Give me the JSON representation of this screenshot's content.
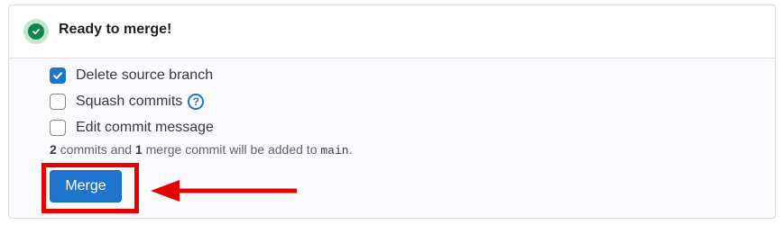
{
  "header": {
    "title": "Ready to merge!",
    "status_icon": "check-circle-icon",
    "status_color": "#108548"
  },
  "options": [
    {
      "label": "Delete source branch",
      "checked": true
    },
    {
      "label": "Squash commits",
      "checked": false,
      "help_icon": "question-circle-icon"
    },
    {
      "label": "Edit commit message",
      "checked": false
    }
  ],
  "summary": {
    "commit_count": "2",
    "commits_text": " commits and ",
    "merge_commit_count": "1",
    "merge_commit_text": " merge commit will be added to ",
    "target_branch": "main",
    "end": "."
  },
  "merge_button": {
    "label": "Merge",
    "color": "#1f75cb"
  },
  "annotation": {
    "highlight_color": "#e60000",
    "arrow_icon": "left-arrow-icon"
  }
}
